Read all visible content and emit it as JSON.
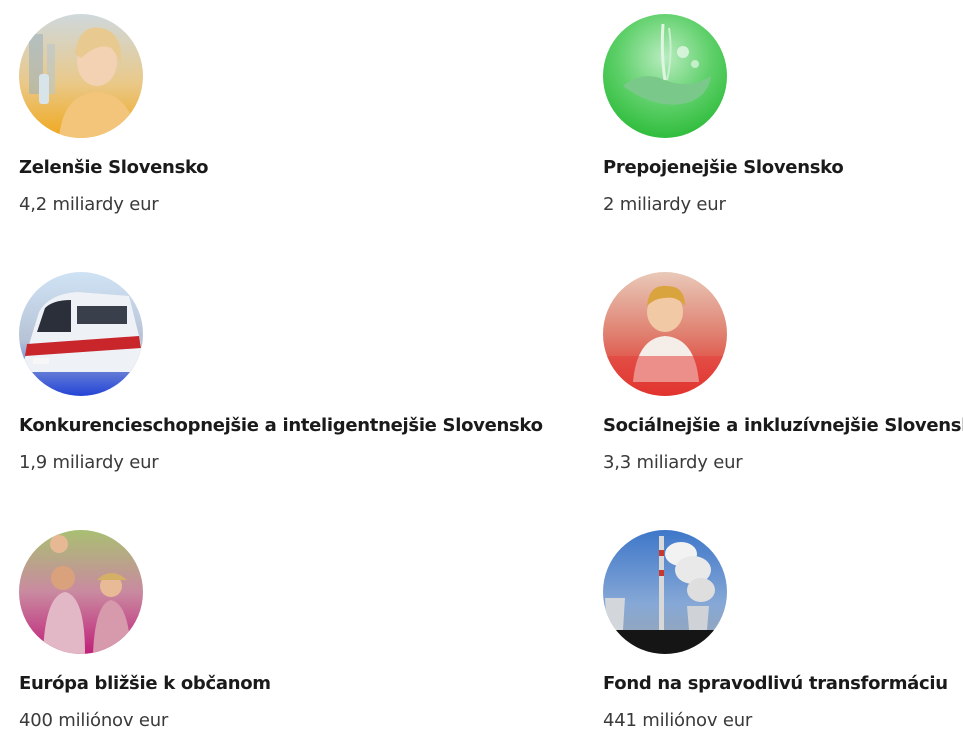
{
  "cards": [
    {
      "title": "Zelenšie Slovensko",
      "amount": "4,2 miliardy eur",
      "image": "scientist-photo",
      "accent": "#f2b530"
    },
    {
      "title": "Prepojenejšie Slovensko",
      "amount": "2 miliardy eur",
      "image": "hands-water-photo",
      "accent": "#2fbf3a"
    },
    {
      "title": "Konkurencieschopnejšie a inteligentnejšie Slovensko",
      "amount": "1,9 miliardy eur",
      "image": "train-photo",
      "accent": "#2e4fd8"
    },
    {
      "title": "Sociálnejšie a inkluzívnejšie Slovensko",
      "amount": "3,3 miliardy eur",
      "image": "child-classroom-photo",
      "accent": "#e0241f"
    },
    {
      "title": "Európa bližšie k občanom",
      "amount": "400 miliónov eur",
      "image": "family-photo",
      "accent": "#c0207a"
    },
    {
      "title": "Fond na spravodlivú transformáciu",
      "amount": "441 miliónov eur",
      "image": "power-plant-photo",
      "accent": "#0e0e0e"
    }
  ]
}
